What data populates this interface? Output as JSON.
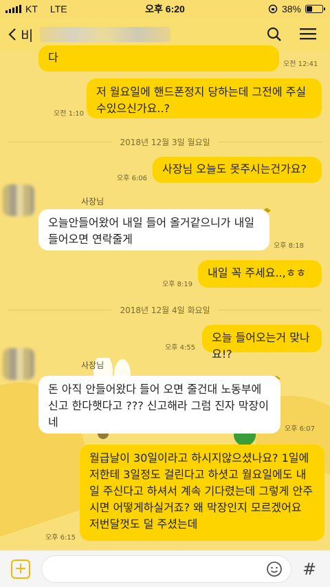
{
  "status": {
    "carrier": "KT",
    "network": "LTE",
    "time": "오후 6:20",
    "battery": "38%",
    "battery_level": 0.38
  },
  "nav": {
    "back_label": "비",
    "title_hidden": "오룰엘지정산 밀저도걸릴거 들어"
  },
  "messages": {
    "m0_text": "다",
    "m0_time": "오전 12:41",
    "m1_text": "저 월요일에 핸드폰정지 당하는데 그전에 주실수있으신가요..?",
    "m1_time": "오전 1:10",
    "day1": "2018년 12월 3일 월요일",
    "m2_text": "사장님 오늘도 못주시는건가요?",
    "m2_time": "오후 6:06",
    "sender1": "사장님",
    "m3_text": "오늘안들어왔어 내일 들어 올거같으니가 내일 들어오면 연락줄게",
    "m3_time": "오후 8:18",
    "m4_text": "내일 꼭 주세요..,ㅎㅎ",
    "m4_time": "오후 8:19",
    "day2": "2018년 12월 4일 화요일",
    "m5_text": "오늘 들어오는거 맞나요!?",
    "m5_time": "오후 4:55",
    "sender2": "사장님",
    "m6_text": "돈 아직 안들어왔다 들어 오면 줄건대 노동부에 신고 한다햇다고 ??? 신고해라 그럼 진자 막장이네",
    "m6_time": "오후 6:07",
    "m7_text": "월급날이 30일이라고 하시지않으셨나요? 1일에 저한테 3일정도 걸린다고 하셧고 월요일에도 내일 주신다고 하셔서 계속 기다렸는데 그렇게 안주시면 어떻게하실거죠? 왜 막장인지 모르겠어요 저번달껏도 덜 주셨는데",
    "m7_time": "오후 6:15"
  },
  "composer": {
    "placeholder": "",
    "plus": "+",
    "hash": "#"
  },
  "icons": {
    "back": "chevron-left-icon",
    "search": "search-icon",
    "menu": "hamburger-icon",
    "emoji": "emoji-icon"
  },
  "colors": {
    "background": "#f9df7a",
    "my_bubble": "#fdd400",
    "their_bubble": "#ffffff"
  }
}
